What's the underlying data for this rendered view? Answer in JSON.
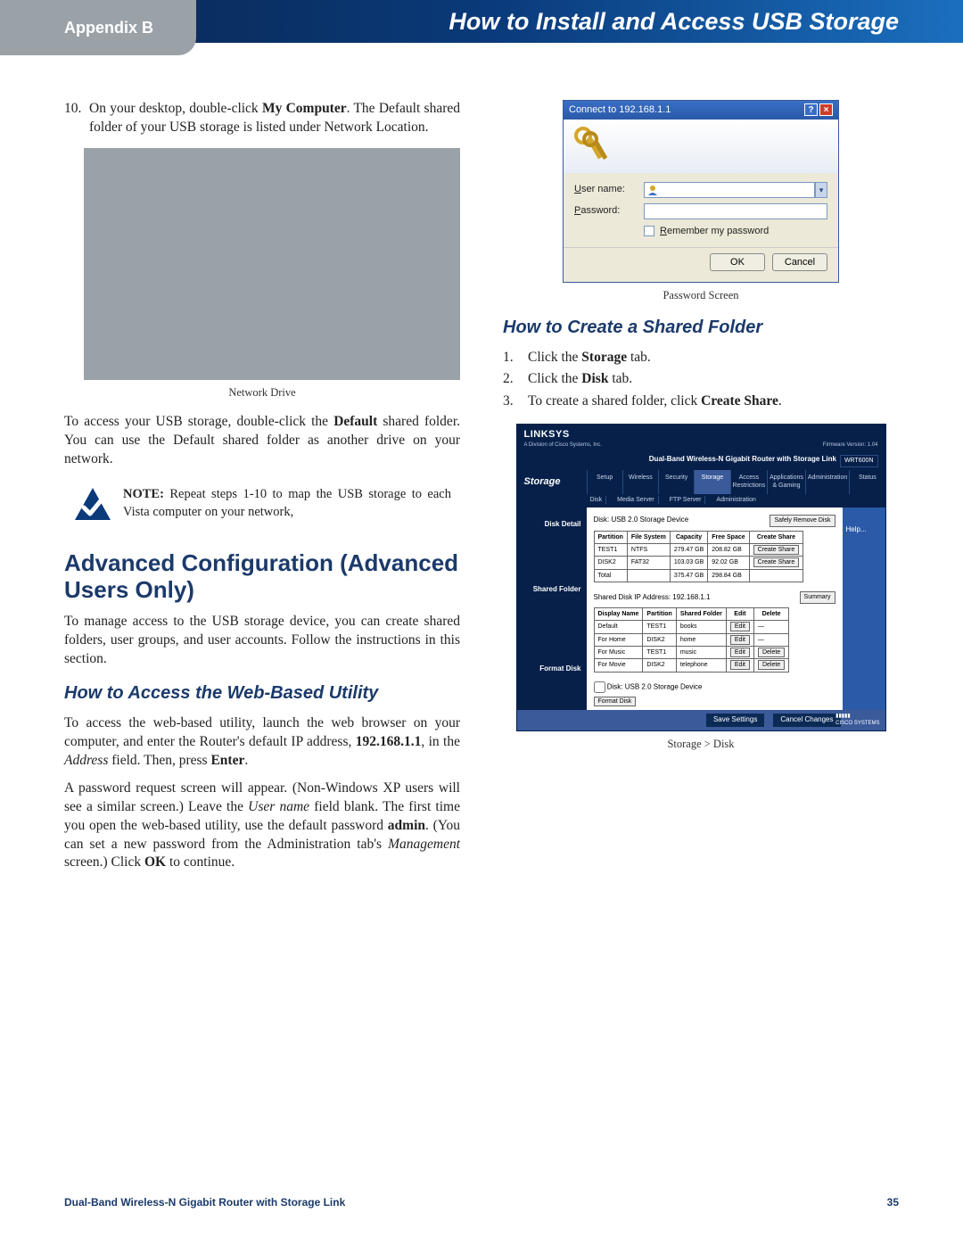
{
  "header": {
    "appendix": "Appendix B",
    "title": "How to Install and Access USB Storage"
  },
  "left": {
    "step10_num": "10.",
    "step10": "On your desktop, double-click ",
    "step10_bold": "My Computer",
    "step10_b": ". The Default shared folder of your USB storage is listed under Network Location.",
    "caption1": "Network Drive",
    "para_access_a": "To access your USB storage, double-click the ",
    "para_access_bold": "Default",
    "para_access_b": " shared folder. You can use the Default shared folder as another drive on your network.",
    "note_label": "NOTE:",
    "note_text": " Repeat steps 1-10 to map the USB storage to each Vista computer on your network,",
    "h1": "Advanced Configuration (Advanced Users Only)",
    "para_adv": "To manage access to the USB storage device, you can create shared folders, user groups, and user accounts. Follow the instructions in this section.",
    "h2": "How to Access the Web-Based Utility",
    "para_web_a": "To access the web-based utility, launch the web browser on your computer, and enter the Router's default IP address, ",
    "ip_bold": "192.168.1.1",
    "para_web_b": ", in the ",
    "addr_ital": "Address",
    "para_web_c": " field. Then, press ",
    "enter_bold": "Enter",
    "para_web_d": ".",
    "para_pw_a": "A password request screen will appear. (Non-Windows XP users will see a similar screen.) Leave the ",
    "username_ital": "User name",
    "para_pw_b": " field blank. The first time you open the web-based utility, use the default password ",
    "admin_bold": "admin",
    "para_pw_c": ". (You can set a new password from the Administration tab's ",
    "mgmt_ital": "Management",
    "para_pw_d": " screen.) Click ",
    "ok_bold": "OK",
    "para_pw_e": " to continue."
  },
  "right": {
    "dlg_title": "Connect to 192.168.1.1",
    "lbl_user": "User name:",
    "lbl_pass": "Password:",
    "chk_label": "Remember my password",
    "btn_ok": "OK",
    "btn_cancel": "Cancel",
    "caption2": "Password Screen",
    "h2": "How to Create a Shared Folder",
    "s1n": "1.",
    "s1a": "Click the ",
    "s1b": "Storage",
    "s1c": " tab.",
    "s2n": "2.",
    "s2a": "Click the ",
    "s2b": "Disk",
    "s2c": " tab.",
    "s3n": "3.",
    "s3a": "To create a shared folder, click ",
    "s3b": "Create Share",
    "s3c": ".",
    "caption3": "Storage > Disk"
  },
  "router": {
    "brand": "LINKSYS",
    "brand_sub": "A Division of Cisco Systems, Inc.",
    "fw": "Firmware Version: 1.04",
    "bandtitle": "Dual-Band Wireless-N Gigabit Router with Storage Link",
    "model": "WRT600N",
    "sidetab": "Storage",
    "tabs": [
      "Setup",
      "Wireless",
      "Security",
      "Storage",
      "Access Restrictions",
      "Applications & Gaming",
      "Administration",
      "Status"
    ],
    "subtabs": [
      "Disk",
      "Media Server",
      "FTP Server",
      "Administration"
    ],
    "left_labels": [
      "Disk Detail",
      "Shared Folder",
      "Format Disk"
    ],
    "disk_label": "Disk: USB 2.0 Storage Device",
    "btn_remove": "Safely Remove Disk",
    "help": "Help...",
    "t1": {
      "headers": [
        "Partition",
        "File System",
        "Capacity",
        "Free Space",
        "Create Share"
      ],
      "rows": [
        [
          "TEST1",
          "NTFS",
          "279.47 GB",
          "208.82 GB",
          "Create Share"
        ],
        [
          "DISK2",
          "FAT32",
          "103.03 GB",
          "92.02 GB",
          "Create Share"
        ],
        [
          "Total",
          "",
          "375.47 GB",
          "298.84 GB",
          ""
        ]
      ]
    },
    "ip_line": "Shared Disk IP Address: 192.168.1.1",
    "btn_summary": "Summary",
    "t2": {
      "headers": [
        "Display Name",
        "Partition",
        "Shared Folder",
        "Edit",
        "Delete"
      ],
      "rows": [
        [
          "Default",
          "TEST1",
          "books",
          "Edit",
          "—"
        ],
        [
          "For Home",
          "DISK2",
          "home",
          "Edit",
          "—"
        ],
        [
          "For Music",
          "TEST1",
          "music",
          "Edit",
          "Delete"
        ],
        [
          "For Movie",
          "DISK2",
          "telephone",
          "Edit",
          "Delete"
        ]
      ]
    },
    "fmt_label": "Disk: USB 2.0 Storage Device",
    "btn_format": "Format Disk",
    "btn_save": "Save Settings",
    "btn_cancel": "Cancel Changes"
  },
  "footer": {
    "product": "Dual-Band Wireless-N Gigabit Router with Storage Link",
    "page": "35"
  }
}
